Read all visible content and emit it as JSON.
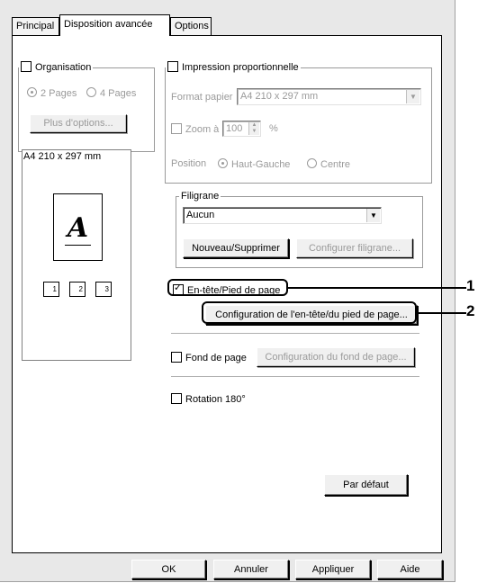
{
  "tabs": [
    "Principal",
    "Disposition avancée",
    "Options"
  ],
  "organisation": {
    "label": "Organisation",
    "radio_2": "2 Pages",
    "radio_4": "4 Pages",
    "more_button": "Plus d'options...",
    "preview_caption": "A4 210 x 297 mm",
    "preview_glyph": "A",
    "mini_pages": [
      "1",
      "2",
      "3"
    ]
  },
  "proportional": {
    "label": "Impression proportionnelle",
    "paper_format_label": "Format papier",
    "paper_format_value": "A4 210 x 297 mm",
    "zoom_label": "Zoom à",
    "zoom_value": "100",
    "zoom_unit": "%",
    "position_label": "Position",
    "pos_top_left": "Haut-Gauche",
    "pos_center": "Centre"
  },
  "watermark": {
    "label": "Filigrane",
    "value": "Aucun",
    "new_delete_button": "Nouveau/Supprimer",
    "configure_button": "Configurer filigrane..."
  },
  "header_footer": {
    "checkbox_label": "En-tête/Pied de page",
    "config_button": "Configuration de l'en-tête/du pied de page..."
  },
  "background": {
    "checkbox_label": "Fond de page",
    "config_button": "Configuration du fond de page..."
  },
  "rotation": {
    "checkbox_label": "Rotation 180°"
  },
  "default_button": "Par défaut",
  "footer_buttons": {
    "ok": "OK",
    "cancel": "Annuler",
    "apply": "Appliquer",
    "help": "Aide"
  },
  "callouts": [
    "1",
    "2"
  ]
}
